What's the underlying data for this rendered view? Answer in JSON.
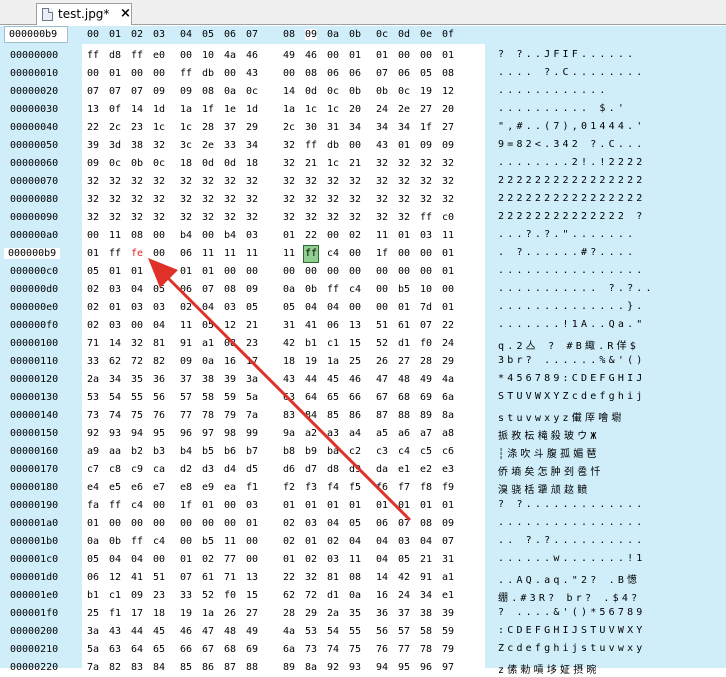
{
  "tab": {
    "filename": "test.jpg*",
    "close": "×"
  },
  "header": {
    "offset": "000000b9",
    "columns": [
      "00",
      "01",
      "02",
      "03",
      "04",
      "05",
      "06",
      "07",
      "08",
      "09",
      "0a",
      "0b",
      "0c",
      "0d",
      "0e",
      "0f"
    ]
  },
  "rows": [
    {
      "offset": "00000000",
      "bytes": [
        "ff",
        "d8",
        "ff",
        "e0",
        "00",
        "10",
        "4a",
        "46",
        "49",
        "46",
        "00",
        "01",
        "01",
        "00",
        "00",
        "01"
      ],
      "ascii": "? ?..JFIF......"
    },
    {
      "offset": "00000010",
      "bytes": [
        "00",
        "01",
        "00",
        "00",
        "ff",
        "db",
        "00",
        "43",
        "00",
        "08",
        "06",
        "06",
        "07",
        "06",
        "05",
        "08"
      ],
      "ascii": ".... ?.C........"
    },
    {
      "offset": "00000020",
      "bytes": [
        "07",
        "07",
        "07",
        "09",
        "09",
        "08",
        "0a",
        "0c",
        "14",
        "0d",
        "0c",
        "0b",
        "0b",
        "0c",
        "19",
        "12"
      ],
      "ascii": "............"
    },
    {
      "offset": "00000030",
      "bytes": [
        "13",
        "0f",
        "14",
        "1d",
        "1a",
        "1f",
        "1e",
        "1d",
        "1a",
        "1c",
        "1c",
        "20",
        "24",
        "2e",
        "27",
        "20"
      ],
      "ascii": ".......... $.'"
    },
    {
      "offset": "00000040",
      "bytes": [
        "22",
        "2c",
        "23",
        "1c",
        "1c",
        "28",
        "37",
        "29",
        "2c",
        "30",
        "31",
        "34",
        "34",
        "34",
        "1f",
        "27"
      ],
      "ascii": "\",#..(7),01444.'"
    },
    {
      "offset": "00000050",
      "bytes": [
        "39",
        "3d",
        "38",
        "32",
        "3c",
        "2e",
        "33",
        "34",
        "32",
        "ff",
        "db",
        "00",
        "43",
        "01",
        "09",
        "09"
      ],
      "ascii": "9=82<.342 ?.C..."
    },
    {
      "offset": "00000060",
      "bytes": [
        "09",
        "0c",
        "0b",
        "0c",
        "18",
        "0d",
        "0d",
        "18",
        "32",
        "21",
        "1c",
        "21",
        "32",
        "32",
        "32",
        "32"
      ],
      "ascii": "........2!.!2222"
    },
    {
      "offset": "00000070",
      "bytes": [
        "32",
        "32",
        "32",
        "32",
        "32",
        "32",
        "32",
        "32",
        "32",
        "32",
        "32",
        "32",
        "32",
        "32",
        "32",
        "32"
      ],
      "ascii": "2222222222222222"
    },
    {
      "offset": "00000080",
      "bytes": [
        "32",
        "32",
        "32",
        "32",
        "32",
        "32",
        "32",
        "32",
        "32",
        "32",
        "32",
        "32",
        "32",
        "32",
        "32",
        "32"
      ],
      "ascii": "2222222222222222"
    },
    {
      "offset": "00000090",
      "bytes": [
        "32",
        "32",
        "32",
        "32",
        "32",
        "32",
        "32",
        "32",
        "32",
        "32",
        "32",
        "32",
        "32",
        "32",
        "ff",
        "c0"
      ],
      "ascii": "22222222222222 ?"
    },
    {
      "offset": "000000a0",
      "bytes": [
        "00",
        "11",
        "08",
        "00",
        "b4",
        "00",
        "b4",
        "03",
        "01",
        "22",
        "00",
        "02",
        "11",
        "01",
        "03",
        "11"
      ],
      "ascii": "...?.?.\"......."
    },
    {
      "offset": "000000b9",
      "bytes": [
        "01",
        "ff",
        "fe",
        "00",
        "06",
        "11",
        "11",
        "11",
        "11",
        "ff",
        "c4",
        "00",
        "1f",
        "00",
        "00",
        "01"
      ],
      "ascii": ". ?......#?....",
      "cursor": true
    },
    {
      "offset": "000000c0",
      "bytes": [
        "05",
        "01",
        "01",
        "01",
        "01",
        "01",
        "00",
        "00",
        "00",
        "00",
        "00",
        "00",
        "00",
        "00",
        "00",
        "01"
      ],
      "ascii": "................"
    },
    {
      "offset": "000000d0",
      "bytes": [
        "02",
        "03",
        "04",
        "05",
        "06",
        "07",
        "08",
        "09",
        "0a",
        "0b",
        "ff",
        "c4",
        "00",
        "b5",
        "10",
        "00"
      ],
      "ascii": "........... ?.?.."
    },
    {
      "offset": "000000e0",
      "bytes": [
        "02",
        "01",
        "03",
        "03",
        "02",
        "04",
        "03",
        "05",
        "05",
        "04",
        "04",
        "00",
        "00",
        "01",
        "7d",
        "01"
      ],
      "ascii": "..............}."
    },
    {
      "offset": "000000f0",
      "bytes": [
        "02",
        "03",
        "00",
        "04",
        "11",
        "05",
        "12",
        "21",
        "31",
        "41",
        "06",
        "13",
        "51",
        "61",
        "07",
        "22"
      ],
      "ascii": ".......!1A..Qa.\""
    },
    {
      "offset": "00000100",
      "bytes": [
        "71",
        "14",
        "32",
        "81",
        "91",
        "a1",
        "08",
        "23",
        "42",
        "b1",
        "c1",
        "15",
        "52",
        "d1",
        "f0",
        "24"
      ],
      "ascii": "q.2亼 ? #B緅.R佯$"
    },
    {
      "offset": "00000110",
      "bytes": [
        "33",
        "62",
        "72",
        "82",
        "09",
        "0a",
        "16",
        "17",
        "18",
        "19",
        "1a",
        "25",
        "26",
        "27",
        "28",
        "29"
      ],
      "ascii": "3br? ......%&'()"
    },
    {
      "offset": "00000120",
      "bytes": [
        "2a",
        "34",
        "35",
        "36",
        "37",
        "38",
        "39",
        "3a",
        "43",
        "44",
        "45",
        "46",
        "47",
        "48",
        "49",
        "4a"
      ],
      "ascii": "*456789:CDEFGHIJ"
    },
    {
      "offset": "00000130",
      "bytes": [
        "53",
        "54",
        "55",
        "56",
        "57",
        "58",
        "59",
        "5a",
        "63",
        "64",
        "65",
        "66",
        "67",
        "68",
        "69",
        "6a"
      ],
      "ascii": "STUVWXYZcdefghij"
    },
    {
      "offset": "00000140",
      "bytes": [
        "73",
        "74",
        "75",
        "76",
        "77",
        "78",
        "79",
        "7a",
        "83",
        "84",
        "85",
        "86",
        "87",
        "88",
        "89",
        "8a"
      ],
      "ascii": "stuvwxyz儎厗噲墛"
    },
    {
      "offset": "00000150",
      "bytes": [
        "92",
        "93",
        "94",
        "95",
        "96",
        "97",
        "98",
        "99",
        "9a",
        "a2",
        "a3",
        "a4",
        "a5",
        "a6",
        "a7",
        "a8"
      ],
      "ascii": "挀敄枟槞殺玻ウЖ"
    },
    {
      "offset": "00000160",
      "bytes": [
        "a9",
        "aa",
        "b2",
        "b3",
        "b4",
        "b5",
        "b6",
        "b7",
        "b8",
        "b9",
        "ba",
        "c2",
        "c3",
        "c4",
        "c5",
        "c6"
      ],
      "ascii": "┆涤吹斗腹孤媚琶"
    },
    {
      "offset": "00000170",
      "bytes": [
        "c7",
        "c8",
        "c9",
        "ca",
        "d2",
        "d3",
        "d4",
        "d5",
        "d6",
        "d7",
        "d8",
        "d9",
        "da",
        "e1",
        "e2",
        "e3"
      ],
      "ascii": "侨墒矣怎肿刭卺忏"
    },
    {
      "offset": "00000180",
      "bytes": [
        "e4",
        "e5",
        "e6",
        "e7",
        "e8",
        "e9",
        "ea",
        "f1",
        "f2",
        "f3",
        "f4",
        "f5",
        "f6",
        "f7",
        "f8",
        "f9"
      ],
      "ascii": "溴骁栝犟颃趑鲼"
    },
    {
      "offset": "00000190",
      "bytes": [
        "fa",
        "ff",
        "c4",
        "00",
        "1f",
        "01",
        "00",
        "03",
        "01",
        "01",
        "01",
        "01",
        "01",
        "01",
        "01",
        "01"
      ],
      "ascii": "? ?............."
    },
    {
      "offset": "000001a0",
      "bytes": [
        "01",
        "00",
        "00",
        "00",
        "00",
        "00",
        "00",
        "01",
        "02",
        "03",
        "04",
        "05",
        "06",
        "07",
        "08",
        "09"
      ],
      "ascii": "................"
    },
    {
      "offset": "000001b0",
      "bytes": [
        "0a",
        "0b",
        "ff",
        "c4",
        "00",
        "b5",
        "11",
        "00",
        "02",
        "01",
        "02",
        "04",
        "04",
        "03",
        "04",
        "07"
      ],
      "ascii": ".. ?.?.........."
    },
    {
      "offset": "000001c0",
      "bytes": [
        "05",
        "04",
        "04",
        "00",
        "01",
        "02",
        "77",
        "00",
        "01",
        "02",
        "03",
        "11",
        "04",
        "05",
        "21",
        "31"
      ],
      "ascii": "......w.......!1"
    },
    {
      "offset": "000001d0",
      "bytes": [
        "06",
        "12",
        "41",
        "51",
        "07",
        "61",
        "71",
        "13",
        "22",
        "32",
        "81",
        "08",
        "14",
        "42",
        "91",
        "a1"
      ],
      "ascii": "..AQ.aq.\"2? .B憽"
    },
    {
      "offset": "000001e0",
      "bytes": [
        "b1",
        "c1",
        "09",
        "23",
        "33",
        "52",
        "f0",
        "15",
        "62",
        "72",
        "d1",
        "0a",
        "16",
        "24",
        "34",
        "e1"
      ],
      "ascii": "绷.#3R? br? .$4?"
    },
    {
      "offset": "000001f0",
      "bytes": [
        "25",
        "f1",
        "17",
        "18",
        "19",
        "1a",
        "26",
        "27",
        "28",
        "29",
        "2a",
        "35",
        "36",
        "37",
        "38",
        "39"
      ],
      "ascii": "? ....&'()*56789"
    },
    {
      "offset": "00000200",
      "bytes": [
        "3a",
        "43",
        "44",
        "45",
        "46",
        "47",
        "48",
        "49",
        "4a",
        "53",
        "54",
        "55",
        "56",
        "57",
        "58",
        "59"
      ],
      "ascii": ":CDEFGHIJSTUVWXY"
    },
    {
      "offset": "00000210",
      "bytes": [
        "5a",
        "63",
        "64",
        "65",
        "66",
        "67",
        "68",
        "69",
        "6a",
        "73",
        "74",
        "75",
        "76",
        "77",
        "78",
        "79"
      ],
      "ascii": "Zcdefghijstuvwxy"
    },
    {
      "offset": "00000220",
      "bytes": [
        "7a",
        "82",
        "83",
        "84",
        "85",
        "86",
        "87",
        "88",
        "89",
        "8a",
        "92",
        "93",
        "94",
        "95",
        "96",
        "97"
      ],
      "ascii": "z傃勑嗊垑姃摂晼"
    }
  ],
  "highlight": {
    "red_row": 11,
    "red_col": 2,
    "selected_row": 11,
    "selected_col": 9
  },
  "colors": {
    "gutter": "#cfeefa",
    "red": "#e02020",
    "selected": "#8fcf8f",
    "arrow": "#e0302a"
  }
}
